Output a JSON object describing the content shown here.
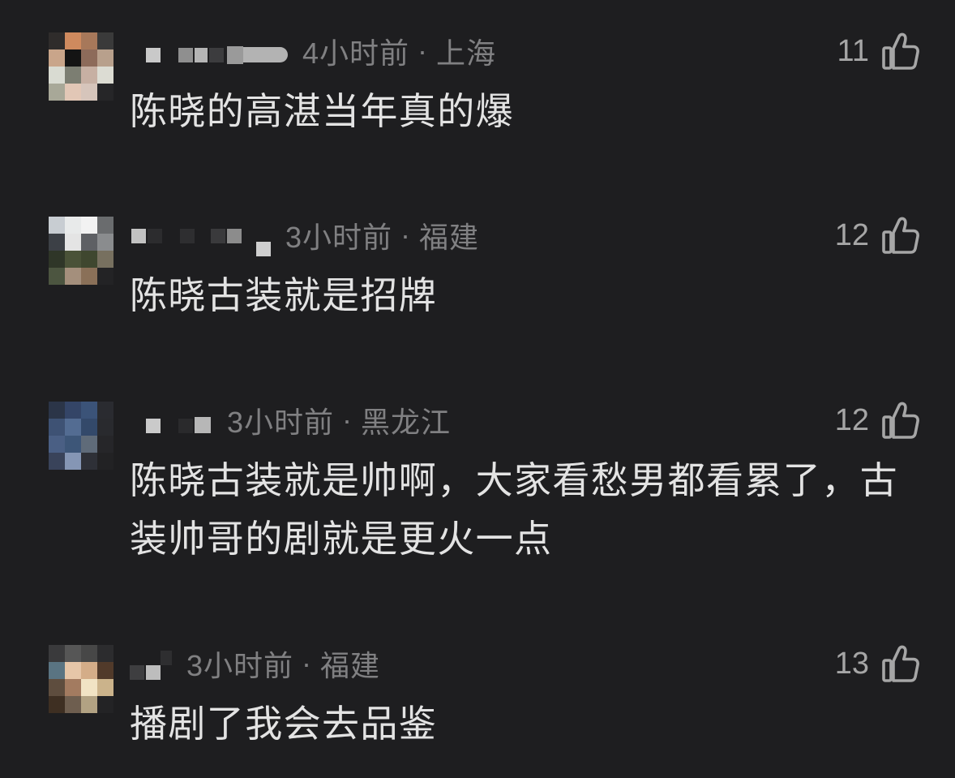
{
  "theme": {
    "background": "#1e1e20",
    "text": "#e3e3e3",
    "meta": "#808082",
    "icon": "#a6a6a6"
  },
  "labels": {
    "separator": "·",
    "like_icon": "thumbs-up-icon"
  },
  "comments": [
    {
      "avatar_pixels": [
        [
          "#2f2c2b",
          "#cf8a5e",
          "#a7785a",
          "#3a3a3a"
        ],
        [
          "#c9a58a",
          "#141414",
          "#8d6b5a",
          "#b8a08c"
        ],
        [
          "#d9dbd2",
          "#7c7e72",
          "#c7b0a3",
          "#dcdcd3"
        ],
        [
          "#a8a898",
          "#e2c7b6",
          "#d6c5bb",
          "#262628"
        ]
      ],
      "time": "4小时前",
      "location": "上海",
      "likes": "11",
      "text": "陈晓的高湛当年真的爆"
    },
    {
      "avatar_pixels": [
        [
          "#c8cdd2",
          "#e8eaea",
          "#f2f2f2",
          "#6a6c6e"
        ],
        [
          "#3c4046",
          "#e4e4e4",
          "#5e6064",
          "#8a8c8e"
        ],
        [
          "#2f3628",
          "#4a5238",
          "#3f472f",
          "#77705f"
        ],
        [
          "#4c5540",
          "#a48f7c",
          "#8a7058",
          "#232325"
        ]
      ],
      "time": "3小时前",
      "location": "福建",
      "likes": "12",
      "text": "陈晓古装就是招牌"
    },
    {
      "avatar_pixels": [
        [
          "#2b3548",
          "#344567",
          "#3b5378",
          "#2a2b30"
        ],
        [
          "#3e5274",
          "#536c92",
          "#33496a",
          "#292a2e"
        ],
        [
          "#4a5f84",
          "#3d5678",
          "#5f6b79",
          "#262629"
        ],
        [
          "#39435a",
          "#8596b5",
          "#2e3037",
          "#222224"
        ]
      ],
      "time": "3小时前",
      "location": "黑龙江",
      "likes": "12",
      "text": "陈晓古装就是帅啊，大家看愁男都看累了，古装帅哥的剧就是更火一点"
    },
    {
      "avatar_pixels": [
        [
          "#3a3a3c",
          "#565656",
          "#474747",
          "#2c2c2e"
        ],
        [
          "#5a7482",
          "#e6c6a8",
          "#d4ad88",
          "#513a2a"
        ],
        [
          "#5e4d3e",
          "#a37b60",
          "#f1e3c4",
          "#cbb38b"
        ],
        [
          "#3e2f22",
          "#6e5e4f",
          "#b2a283",
          "#232325"
        ]
      ],
      "time": "3小时前",
      "location": "福建",
      "likes": "13",
      "text": "播剧了我会去品鉴"
    }
  ]
}
